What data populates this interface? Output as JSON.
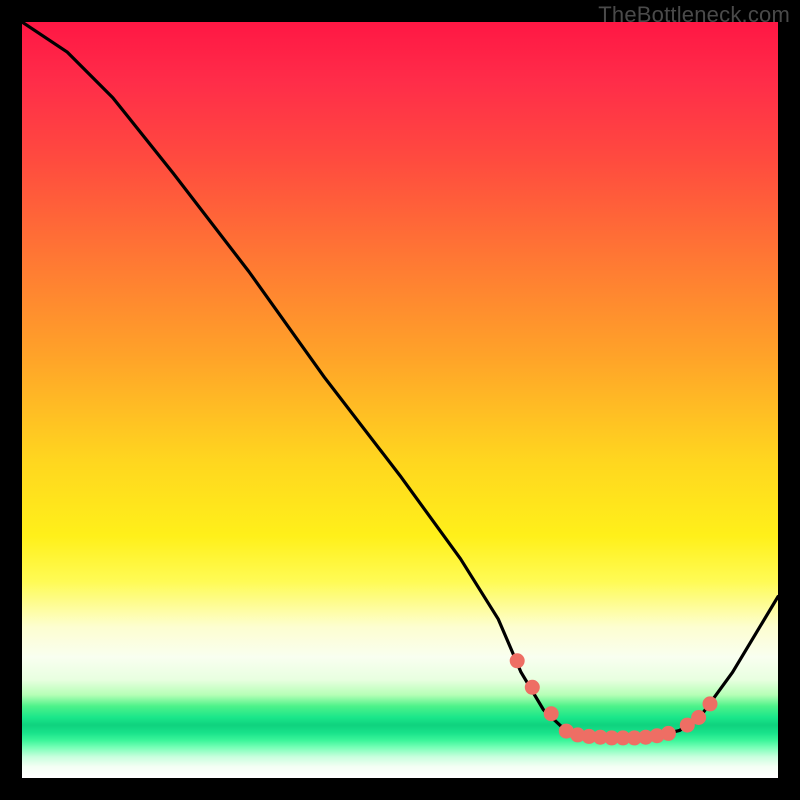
{
  "watermark": "TheBottleneck.com",
  "chart_data": {
    "type": "line",
    "title": "",
    "xlabel": "",
    "ylabel": "",
    "xlim": [
      0,
      100
    ],
    "ylim": [
      0,
      100
    ],
    "series": [
      {
        "name": "curve",
        "points": [
          {
            "x": 0,
            "y": 100
          },
          {
            "x": 6,
            "y": 96
          },
          {
            "x": 12,
            "y": 90
          },
          {
            "x": 20,
            "y": 80
          },
          {
            "x": 30,
            "y": 67
          },
          {
            "x": 40,
            "y": 53
          },
          {
            "x": 50,
            "y": 40
          },
          {
            "x": 58,
            "y": 29
          },
          {
            "x": 63,
            "y": 21
          },
          {
            "x": 66,
            "y": 14
          },
          {
            "x": 69,
            "y": 9
          },
          {
            "x": 72,
            "y": 6.2
          },
          {
            "x": 75,
            "y": 5.5
          },
          {
            "x": 78,
            "y": 5.3
          },
          {
            "x": 81,
            "y": 5.3
          },
          {
            "x": 84,
            "y": 5.6
          },
          {
            "x": 87,
            "y": 6.3
          },
          {
            "x": 90,
            "y": 8.5
          },
          {
            "x": 94,
            "y": 14
          },
          {
            "x": 100,
            "y": 24
          }
        ]
      }
    ],
    "markers": [
      {
        "x": 65.5,
        "y": 15.5
      },
      {
        "x": 67.5,
        "y": 12
      },
      {
        "x": 70,
        "y": 8.5
      },
      {
        "x": 72,
        "y": 6.2
      },
      {
        "x": 73.5,
        "y": 5.7
      },
      {
        "x": 75,
        "y": 5.5
      },
      {
        "x": 76.5,
        "y": 5.4
      },
      {
        "x": 78,
        "y": 5.3
      },
      {
        "x": 79.5,
        "y": 5.3
      },
      {
        "x": 81,
        "y": 5.3
      },
      {
        "x": 82.5,
        "y": 5.4
      },
      {
        "x": 84,
        "y": 5.6
      },
      {
        "x": 85.5,
        "y": 5.9
      },
      {
        "x": 88,
        "y": 7.0
      },
      {
        "x": 89.5,
        "y": 8.0
      },
      {
        "x": 91,
        "y": 9.8
      }
    ],
    "gradient_note": "background is a perceptual bottleneck severity scale: red=top=high, green band near bottom=optimal"
  }
}
